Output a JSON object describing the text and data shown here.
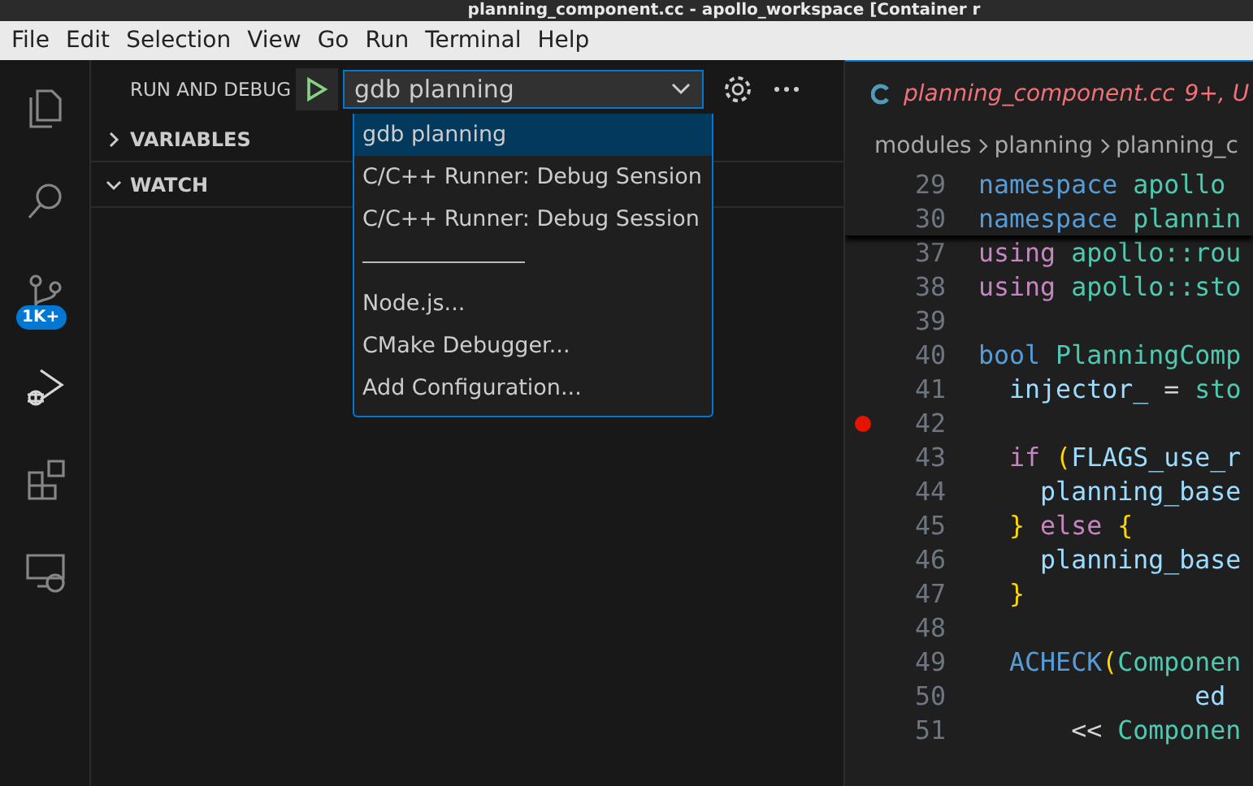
{
  "window": {
    "title": "planning_component.cc - apollo_workspace [Container r"
  },
  "menu": [
    "File",
    "Edit",
    "Selection",
    "View",
    "Go",
    "Run",
    "Terminal",
    "Help"
  ],
  "activity_bar": [
    {
      "kind": "files",
      "selected": false
    },
    {
      "kind": "search",
      "selected": false
    },
    {
      "kind": "source-control",
      "selected": false,
      "badge": "1K+"
    },
    {
      "kind": "run-debug",
      "selected": true
    },
    {
      "kind": "extensions",
      "selected": false
    },
    {
      "kind": "remote",
      "selected": false
    }
  ],
  "sidebar": {
    "title": "RUN AND DEBUG",
    "config": "gdb planning",
    "sections": [
      {
        "label": "VARIABLES",
        "expanded": false
      },
      {
        "label": "WATCH",
        "expanded": true
      }
    ],
    "dropdown": [
      {
        "kind": "option",
        "label": "gdb planning",
        "selected": true
      },
      {
        "kind": "option",
        "label": "C/C++ Runner: Debug Sension",
        "selected": false
      },
      {
        "kind": "option",
        "label": "C/C++ Runner: Debug Session",
        "selected": false
      },
      {
        "kind": "separator"
      },
      {
        "kind": "option",
        "label": "Node.js...",
        "selected": false
      },
      {
        "kind": "option",
        "label": "CMake Debugger...",
        "selected": false
      },
      {
        "kind": "option",
        "label": "Add Configuration...",
        "selected": false
      }
    ]
  },
  "editor": {
    "tab": {
      "name": "planning_component.cc",
      "status": "9+, U"
    },
    "breadcrumbs": [
      "modules",
      "planning",
      "planning_c"
    ],
    "sticky_lines": [
      {
        "num": "29",
        "tokens": [
          {
            "t": "namespace",
            "kind": "keyword"
          },
          {
            "t": " apollo",
            "kind": "type"
          }
        ]
      },
      {
        "num": "30",
        "tokens": [
          {
            "t": "namespace",
            "kind": "keyword"
          },
          {
            "t": " plannin",
            "kind": "type"
          }
        ]
      }
    ],
    "lines": [
      {
        "num": "37",
        "breakpoint": false,
        "tokens": [
          {
            "t": "using",
            "kind": "control"
          },
          {
            "t": " apollo::rou",
            "kind": "type"
          }
        ]
      },
      {
        "num": "38",
        "breakpoint": false,
        "tokens": [
          {
            "t": "using",
            "kind": "control"
          },
          {
            "t": " apollo::sto",
            "kind": "type"
          }
        ]
      },
      {
        "num": "39",
        "breakpoint": false
      },
      {
        "num": "40",
        "breakpoint": false,
        "tokens": [
          {
            "t": "bool",
            "kind": "keyword"
          },
          {
            "t": " PlanningComp",
            "kind": "type"
          }
        ]
      },
      {
        "num": "41",
        "breakpoint": false,
        "tokens": [
          {
            "t": "  injector_",
            "kind": "variable"
          },
          {
            "t": " = ",
            "kind": "plain"
          },
          {
            "t": "sto",
            "kind": "type"
          }
        ]
      },
      {
        "num": "42",
        "breakpoint": true
      },
      {
        "num": "43",
        "breakpoint": false,
        "tokens": [
          {
            "t": "  if",
            "kind": "control"
          },
          {
            "t": " (",
            "kind": "brace"
          },
          {
            "t": "FLAGS_use_r",
            "kind": "variable"
          }
        ]
      },
      {
        "num": "44",
        "breakpoint": false,
        "tokens": [
          {
            "t": "    planning_base",
            "kind": "variable"
          }
        ]
      },
      {
        "num": "45",
        "breakpoint": false,
        "tokens": [
          {
            "t": "  }",
            "kind": "brace"
          },
          {
            "t": " else",
            "kind": "control"
          },
          {
            "t": " {",
            "kind": "brace"
          }
        ]
      },
      {
        "num": "46",
        "breakpoint": false,
        "tokens": [
          {
            "t": "    planning_base",
            "kind": "variable"
          }
        ]
      },
      {
        "num": "47",
        "breakpoint": false,
        "tokens": [
          {
            "t": "  }",
            "kind": "brace"
          }
        ]
      },
      {
        "num": "48",
        "breakpoint": false
      },
      {
        "num": "49",
        "breakpoint": false,
        "tokens": [
          {
            "t": "  ACHECK",
            "kind": "keyword"
          },
          {
            "t": "(",
            "kind": "brace"
          },
          {
            "t": "Componen",
            "kind": "type"
          }
        ]
      },
      {
        "num": "50",
        "breakpoint": false,
        "tokens": [
          {
            "t": "              ed",
            "kind": "variable"
          }
        ]
      },
      {
        "num": "51",
        "breakpoint": false,
        "tokens": [
          {
            "t": "      << ",
            "kind": "plain"
          },
          {
            "t": "Componen",
            "kind": "type"
          }
        ]
      }
    ]
  }
}
